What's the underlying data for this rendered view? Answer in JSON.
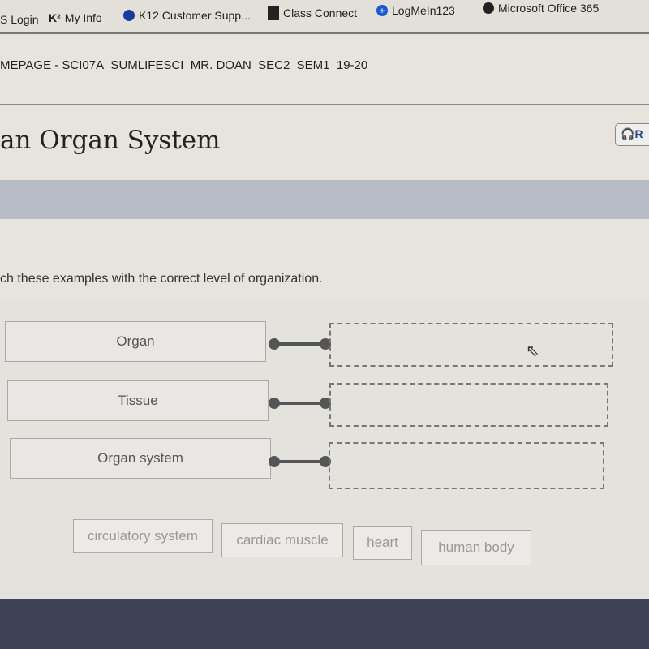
{
  "bookmarks": [
    {
      "label": "S Login",
      "icon": "none"
    },
    {
      "label": "My Info",
      "icon": "k12-logo-icon"
    },
    {
      "label": "K12 Customer Supp...",
      "icon": "salesforce-cloud-icon"
    },
    {
      "label": "Class Connect",
      "icon": "square-icon"
    },
    {
      "label": "LogMeIn123",
      "icon": "plus-circle-icon"
    },
    {
      "label": "Microsoft Office 365",
      "icon": "globe-icon"
    }
  ],
  "breadcrumb": "MEPAGE - SCI07A_SUMLIFESCI_MR. DOAN_SEC2_SEM1_19-20",
  "title": "an Organ System",
  "read_button": "R",
  "instructions": "ch these examples with the correct level of organization.",
  "targets": [
    {
      "label": "Organ"
    },
    {
      "label": "Tissue"
    },
    {
      "label": "Organ system"
    }
  ],
  "tiles": [
    {
      "label": "circulatory system"
    },
    {
      "label": "cardiac muscle"
    },
    {
      "label": "heart"
    },
    {
      "label": "human body"
    }
  ]
}
